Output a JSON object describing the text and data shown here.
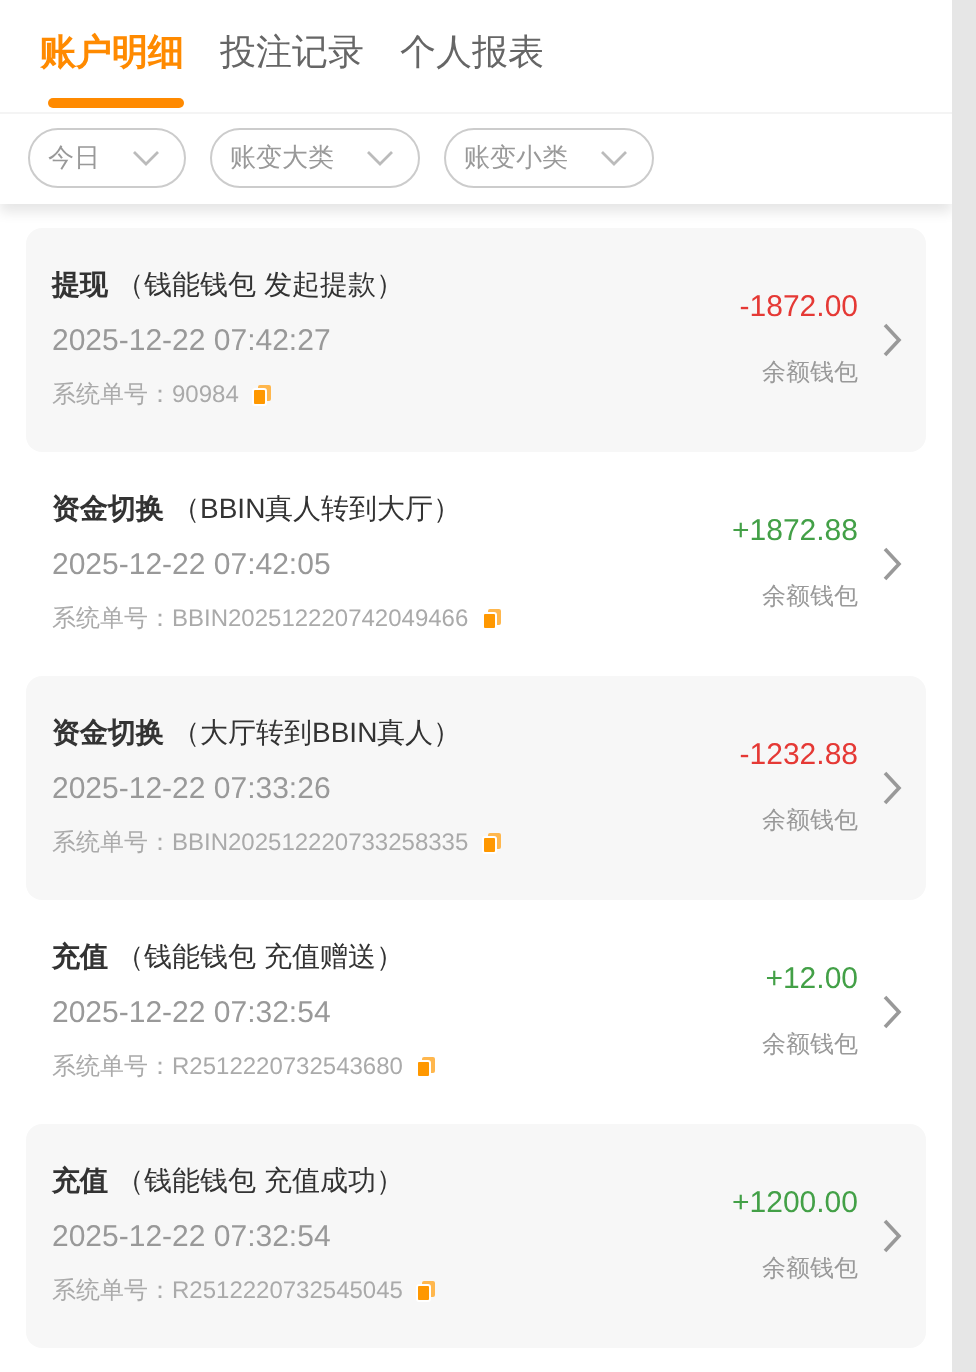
{
  "tabs": [
    {
      "label": "账户明细",
      "selected": true
    },
    {
      "label": "投注记录",
      "selected": false
    },
    {
      "label": "个人报表",
      "selected": false
    }
  ],
  "filters": [
    {
      "label": "今日"
    },
    {
      "label": "账变大类"
    },
    {
      "label": "账变小类"
    }
  ],
  "records": [
    {
      "title": "提现",
      "detail": "（钱能钱包 发起提款）",
      "time": "2025-12-22 07:42:27",
      "order": "系统单号：90984",
      "amount": "-1872.00",
      "color": "#e53935",
      "wallet": "余额钱包"
    },
    {
      "title": "资金切换",
      "detail": "（BBIN真人转到大厅）",
      "time": "2025-12-22 07:42:05",
      "order": "系统单号：BBIN202512220742049466",
      "amount": "+1872.88",
      "color": "#43a047",
      "wallet": "余额钱包"
    },
    {
      "title": "资金切换",
      "detail": "（大厅转到BBIN真人）",
      "time": "2025-12-22 07:33:26",
      "order": "系统单号：BBIN202512220733258335",
      "amount": "-1232.88",
      "color": "#e53935",
      "wallet": "余额钱包"
    },
    {
      "title": "充值",
      "detail": "（钱能钱包 充值赠送）",
      "time": "2025-12-22 07:32:54",
      "order": "系统单号：R2512220732543680",
      "amount": "+12.00",
      "color": "#43a047",
      "wallet": "余额钱包"
    },
    {
      "title": "充值",
      "detail": "（钱能钱包 充值成功）",
      "time": "2025-12-22 07:32:54",
      "order": "系统单号：R2512220732545045",
      "amount": "+1200.00",
      "color": "#43a047",
      "wallet": "余额钱包"
    }
  ]
}
